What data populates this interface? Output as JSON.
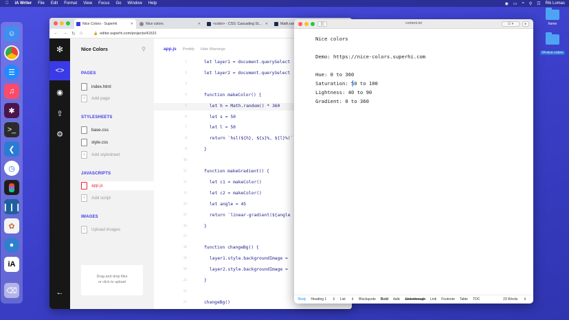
{
  "menubar": {
    "app": "iA Writer",
    "items": [
      "File",
      "Edit",
      "Format",
      "View",
      "Focus",
      "Go",
      "Window",
      "Help"
    ],
    "user": "Rik Lomas"
  },
  "desktop": {
    "folders": [
      {
        "label": "home"
      },
      {
        "label": "04-nice-colors"
      }
    ]
  },
  "browser": {
    "tabs": [
      {
        "title": "Nice Colors - SuperHi"
      },
      {
        "title": "Nice colors"
      },
      {
        "title": "<color> - CSS: Cascading St..."
      },
      {
        "title": "Math.ran"
      }
    ],
    "url": "editor.superhi.com/projects/41531"
  },
  "editor": {
    "project_name": "Nice Colors",
    "sections": {
      "pages": "PAGES",
      "stylesheets": "STYLESHEETS",
      "javascripts": "JAVASCRIPTS",
      "images": "IMAGES"
    },
    "pages": [
      "index.html"
    ],
    "add_page": "Add page",
    "stylesheets": [
      "base.css",
      "style.css"
    ],
    "add_stylesheet": "Add stylesheet",
    "javascripts": [
      "app.js"
    ],
    "add_script": "Add script",
    "upload_images": "Upload images",
    "dropzone": [
      "Drag and drop files",
      "or click to upload"
    ],
    "toolbar": {
      "file": "app.js",
      "prettify": "Prettify",
      "warnings": "Hide Warnings"
    },
    "code_lines": [
      {
        "n": "1",
        "text": "let layer1 = document.querySelect",
        "indent": 0
      },
      {
        "n": "2",
        "text": "let layer2 = document.querySelect",
        "indent": 0
      },
      {
        "n": "3",
        "text": "",
        "indent": 0
      },
      {
        "n": "4",
        "text": "function makeColor() {",
        "indent": 0
      },
      {
        "n": "5",
        "text": "let h = Math.random() * 360",
        "indent": 1
      },
      {
        "n": "6",
        "text": "let s = 50",
        "indent": 1
      },
      {
        "n": "7",
        "text": "let l = 50",
        "indent": 1
      },
      {
        "n": "8",
        "text": "return `hsl(${h}, ${s}%, ${l}%)`",
        "indent": 1
      },
      {
        "n": "9",
        "text": "}",
        "indent": 0
      },
      {
        "n": "10",
        "text": "",
        "indent": 0
      },
      {
        "n": "11",
        "text": "function makeGradient() {",
        "indent": 0
      },
      {
        "n": "12",
        "text": "let c1 = makeColor()",
        "indent": 1
      },
      {
        "n": "13",
        "text": "let c2 = makeColor()",
        "indent": 1
      },
      {
        "n": "14",
        "text": "let angle = 45",
        "indent": 1
      },
      {
        "n": "15",
        "text": "return `linear-gradient(${angle",
        "indent": 1
      },
      {
        "n": "16",
        "text": "}",
        "indent": 0
      },
      {
        "n": "17",
        "text": "",
        "indent": 0
      },
      {
        "n": "18",
        "text": "function changeBg() {",
        "indent": 0
      },
      {
        "n": "19",
        "text": "layer1.style.backgroundImage =",
        "indent": 1
      },
      {
        "n": "20",
        "text": "layer2.style.backgroundImage =",
        "indent": 1
      },
      {
        "n": "21",
        "text": "}",
        "indent": 0
      },
      {
        "n": "22",
        "text": "",
        "indent": 0
      },
      {
        "n": "23",
        "text": "changeBg()",
        "indent": 0
      }
    ]
  },
  "writer": {
    "filename": "content.txt",
    "lines": [
      "Nice colors",
      "",
      "Demo: https://nice-colors.superhi.com",
      "",
      "Hue: 0 to 360",
      "Saturation: 50 to 100",
      "Lightness: 40 to 90",
      "Gradient: 0 to 360"
    ],
    "status": [
      "Body",
      "Heading 1",
      "List",
      "Blockquote",
      "Bold",
      "Italic",
      "Strikethrough",
      "Link",
      "Footnote",
      "Table",
      "TOC"
    ],
    "word_count": "23 Words"
  }
}
